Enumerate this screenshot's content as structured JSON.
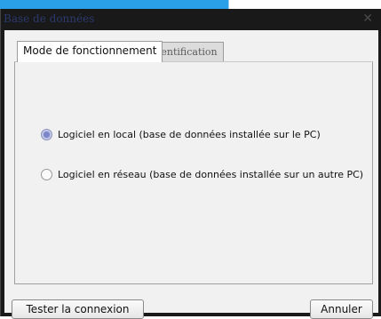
{
  "window": {
    "title": "Base de données",
    "close_glyph": "✕"
  },
  "tabs": [
    {
      "label": "Mode de fonctionnement",
      "active": true
    },
    {
      "label": "Identification",
      "active": false
    }
  ],
  "options": [
    {
      "label": "Logiciel en local (base de données installée sur le PC)",
      "checked": true
    },
    {
      "label": "Logiciel en réseau (base de données installée sur un autre PC)",
      "checked": false
    }
  ],
  "buttons": {
    "test": "Tester la connexion",
    "cancel": "Annuler"
  },
  "colors": {
    "accent": "#2aa0e8",
    "title_text": "#2b3a6e",
    "radio_selected": "#7c86c9"
  }
}
